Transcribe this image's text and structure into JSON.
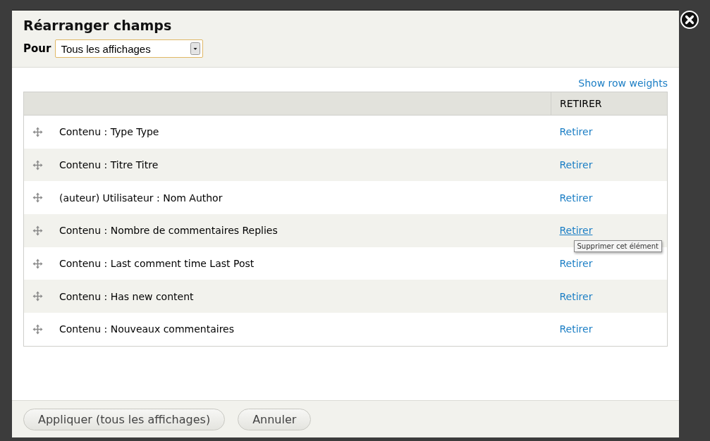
{
  "dialog": {
    "title": "Réarranger champs",
    "for_label": "Pour",
    "for_value": "Tous les affichages"
  },
  "show_weights_link": "Show row weights",
  "table": {
    "columns": [
      "",
      "RETIRER"
    ],
    "rows": [
      {
        "label": "Contenu : Type Type",
        "action": "Retirer",
        "hovered": false
      },
      {
        "label": "Contenu : Titre Titre",
        "action": "Retirer",
        "hovered": false
      },
      {
        "label": "(auteur) Utilisateur : Nom Author",
        "action": "Retirer",
        "hovered": false
      },
      {
        "label": "Contenu : Nombre de commentaires Replies",
        "action": "Retirer",
        "hovered": true,
        "tooltip": "Supprimer cet élément"
      },
      {
        "label": "Contenu : Last comment time Last Post",
        "action": "Retirer",
        "hovered": false
      },
      {
        "label": "Contenu : Has new content",
        "action": "Retirer",
        "hovered": false
      },
      {
        "label": "Contenu : Nouveaux commentaires",
        "action": "Retirer",
        "hovered": false
      }
    ]
  },
  "buttons": [
    "Appliquer (tous les affichages)",
    "Annuler"
  ]
}
